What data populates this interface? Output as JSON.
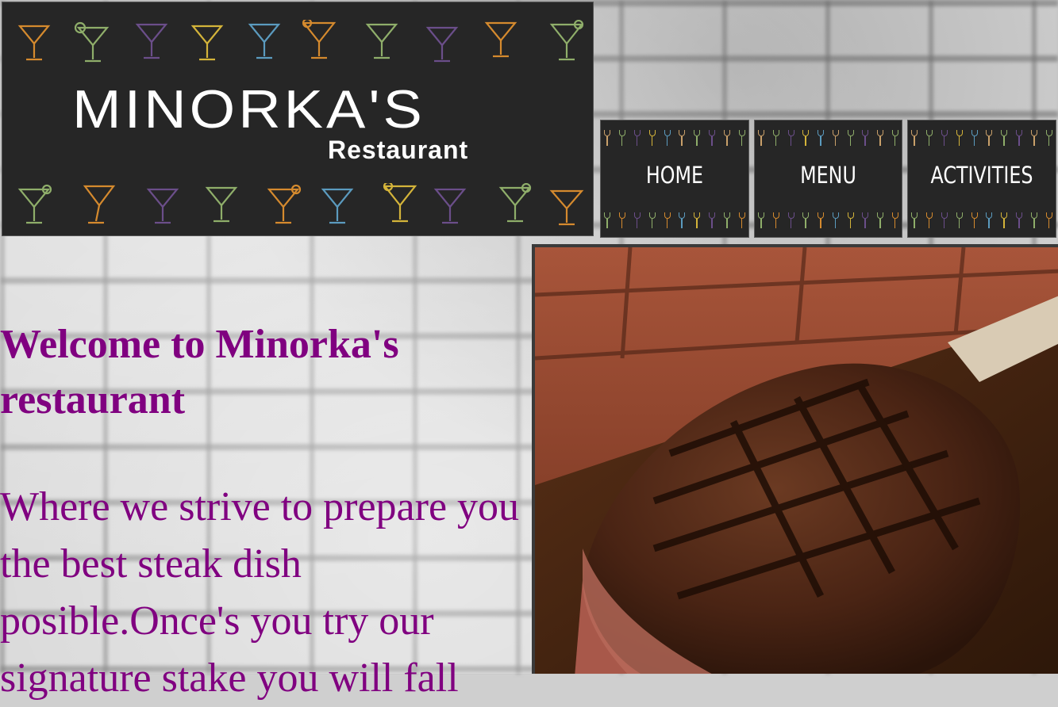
{
  "logo": {
    "title": "MINORKA'S",
    "subtitle": "Restaurant"
  },
  "nav": {
    "items": [
      {
        "label": "HOME"
      },
      {
        "label": "MENU"
      },
      {
        "label": "ACTIVITIES"
      }
    ]
  },
  "main": {
    "heading": "Welcome to Minorka's restaurant",
    "intro": "Where we strive to prepare you the best steak dish posible.Once's you try our signature stake you will fall"
  },
  "photo": {
    "subject": "grilled tomahawk steak on wooden board"
  },
  "colors": {
    "text_accent": "#800080",
    "banner_bg": "#262626",
    "glass_colors": [
      "#d58a2e",
      "#8fae6a",
      "#6b4e8a",
      "#d4b43a",
      "#5b9bbf"
    ]
  }
}
